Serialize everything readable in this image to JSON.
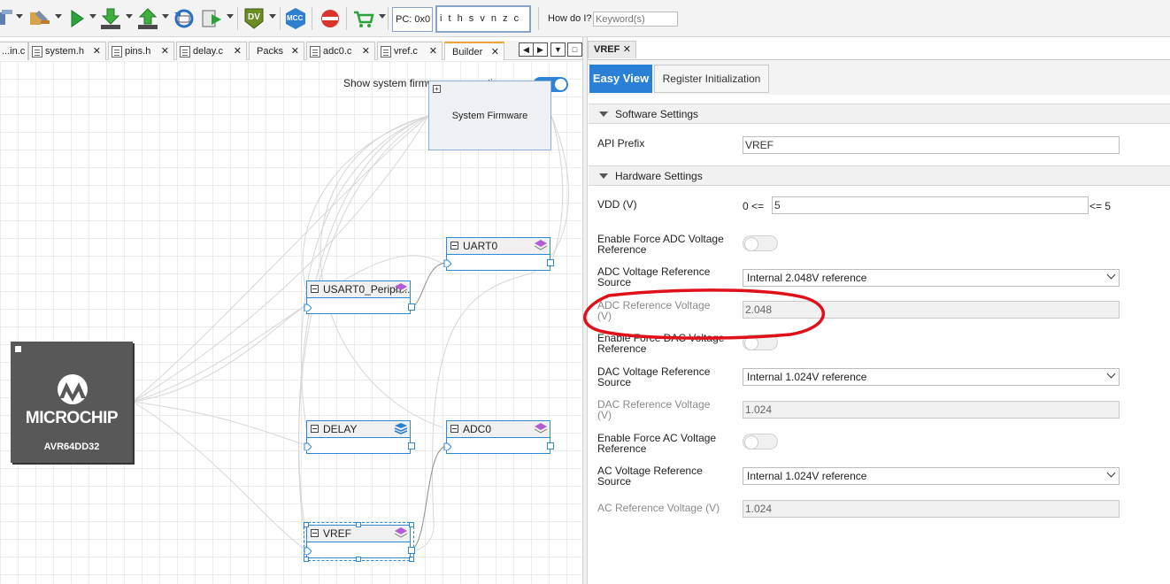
{
  "toolbar": {
    "pc_label": "PC: 0x0",
    "flags": "i t h s v n z c",
    "howdoi_label": "How do I?",
    "keyword_placeholder": "Keyword(s)",
    "dv_label": "DV",
    "mcc_label": "MCC",
    "icons": [
      "build-icon",
      "clean-build-icon",
      "run-icon",
      "program-device-icon",
      "read-device-icon",
      "reset-icon",
      "debug-icon",
      "data-visualizer-icon",
      "mcc-icon",
      "harmony-icon",
      "cart-icon"
    ]
  },
  "editor_tabs": [
    {
      "label": "...in.c"
    },
    {
      "label": "system.h"
    },
    {
      "label": "pins.h"
    },
    {
      "label": "delay.c"
    },
    {
      "label": "Packs"
    },
    {
      "label": "adc0.c"
    },
    {
      "label": "vref.c"
    },
    {
      "label": "Builder"
    }
  ],
  "builder": {
    "toggle_label": "Show system firmware connections",
    "toggle_on": true,
    "system_firmware": "System Firmware",
    "nodes": {
      "uart0": "UART0",
      "usart0": "USART0_Periph...",
      "delay": "DELAY",
      "adc0": "ADC0",
      "vref": "VREF"
    },
    "chip": {
      "brand": "MICROCHIP",
      "part": "AVR64DD32"
    }
  },
  "panel": {
    "tab": "VREF",
    "subtabs": {
      "easy_view": "Easy View",
      "register_init": "Register Initialization"
    },
    "software_settings": {
      "title": "Software Settings",
      "api_prefix_label": "API Prefix",
      "api_prefix_value": "VREF"
    },
    "hardware_settings": {
      "title": "Hardware Settings",
      "vdd_label": "VDD (V)",
      "vdd_prefix": "0 <=",
      "vdd_value": "5",
      "vdd_suffix": "<= 5",
      "adc_force_label_1": "Enable Force ADC Voltage",
      "adc_force_label_2": "Reference",
      "adc_src_label_1": "ADC Voltage Reference",
      "adc_src_label_2": "Source",
      "adc_src_value": "Internal 2.048V reference",
      "adc_ref_label_1": "ADC Reference Voltage",
      "adc_ref_label_2": "(V)",
      "adc_ref_value": "2.048",
      "dac_force_label_1": "Enable Force DAC Voltage",
      "dac_force_label_2": "Reference",
      "dac_src_label_1": "DAC Voltage Reference",
      "dac_src_label_2": "Source",
      "dac_src_value": "Internal 1.024V reference",
      "dac_ref_label_1": "DAC Reference Voltage",
      "dac_ref_label_2": "(V)",
      "dac_ref_value": "1.024",
      "ac_force_label_1": "Enable Force AC Voltage",
      "ac_force_label_2": "Reference",
      "ac_src_label_1": "AC Voltage Reference",
      "ac_src_label_2": "Source",
      "ac_src_value": "Internal 1.024V reference",
      "ac_ref_label": "AC Reference Voltage (V)",
      "ac_ref_value": "1.024"
    }
  },
  "colors": {
    "accent": "#2980d6",
    "annotation": "#e0101a",
    "node_border": "#2a8ad8"
  }
}
